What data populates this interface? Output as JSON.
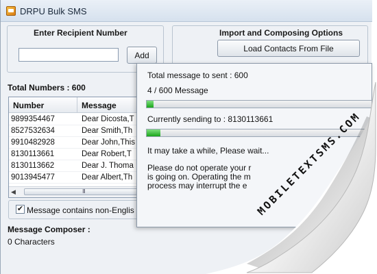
{
  "window": {
    "title": "DRPU Bulk SMS"
  },
  "recipient": {
    "section_title": "Enter Recipient Number",
    "input_value": "",
    "add_label": "Add"
  },
  "import": {
    "section_title": "Import and Composing Options",
    "load_contacts_label": "Load Contacts From File"
  },
  "total_numbers": "Total Numbers : 600",
  "table": {
    "columns": [
      "Number",
      "Message"
    ],
    "rows": [
      [
        "9899354467",
        "Dear Dicosta,T"
      ],
      [
        "8527532634",
        "Dear Smith,Th"
      ],
      [
        "9910482928",
        "Dear John,This"
      ],
      [
        "8130113661",
        "Dear Robert,T"
      ],
      [
        "8130113662",
        "Dear J. Thoma"
      ],
      [
        "9013945477",
        "Dear Albert,Th"
      ]
    ],
    "scroll_grip": "III"
  },
  "unicode_checkbox": {
    "checked": true,
    "label": "Message contains non-Englis"
  },
  "composer": {
    "label": "Message Composer :",
    "chars": "0 Characters"
  },
  "progress": {
    "total_text": "Total message to sent :  600",
    "count_text": "4 / 600 Message",
    "overall_fraction": 0.0067,
    "current_text": "Currently sending to : 8130113661",
    "current_fraction": 0.06,
    "wait_text": "It may take a while, Please wait...",
    "warning_lines": [
      "Please do not operate your r",
      "is going on. Operating the m",
      "process may interrupt the e"
    ]
  },
  "watermark": "MOBILETEXTSMS.COM",
  "colors": {
    "progress_green": "#1aa51a",
    "titlebar": "#dbe5f0"
  },
  "icons": {
    "app": "app-sms-icon",
    "checkbox": "check-icon"
  }
}
